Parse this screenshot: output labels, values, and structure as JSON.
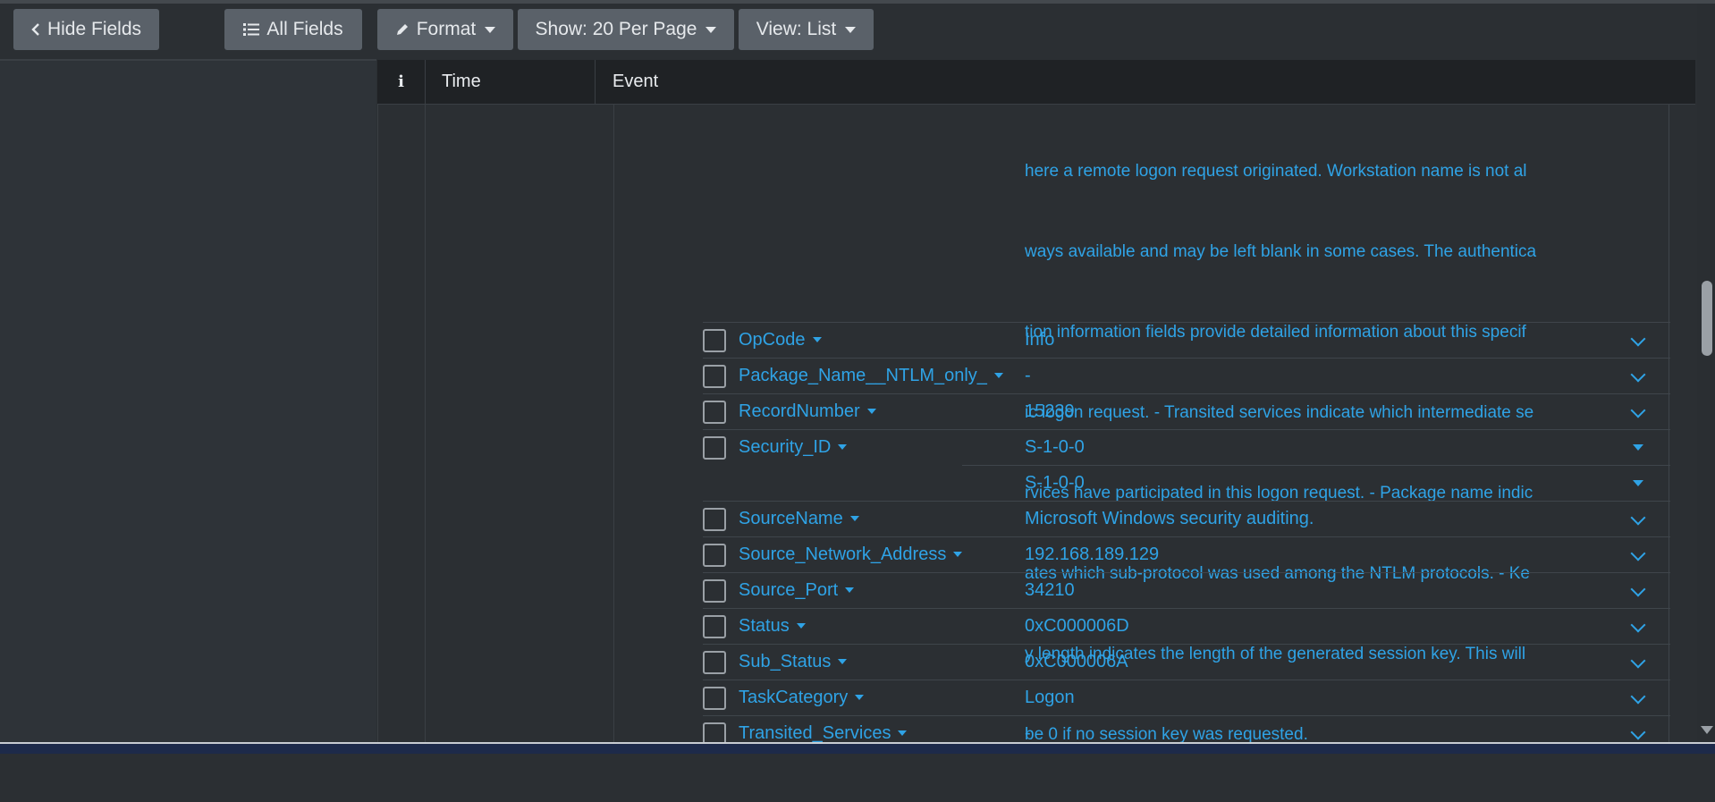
{
  "toolbar": {
    "hide_fields": "Hide Fields",
    "all_fields": "All Fields",
    "format": "Format",
    "show": "Show: 20 Per Page",
    "view": "View: List"
  },
  "table": {
    "col_info": "i",
    "col_time": "Time",
    "col_event": "Event"
  },
  "message_lines": [
    "here a remote logon request originated. Workstation name is not al",
    "ways available and may be left blank in some cases. The authentica",
    "tion information fields provide detailed information about this specif",
    "ic logon request. - Transited services indicate which intermediate se",
    "rvices have participated in this logon request. - Package name indic",
    "ates which sub-protocol was used among the NTLM protocols. - Ke",
    "y length indicates the length of the generated session key. This will",
    "be 0 if no session key was requested."
  ],
  "fields": [
    {
      "name": "OpCode",
      "value": "Info"
    },
    {
      "name": "Package_Name__NTLM_only_",
      "value": "-"
    },
    {
      "name": "RecordNumber",
      "value": "15239"
    },
    {
      "name": "Security_ID",
      "value": "S-1-0-0",
      "value2": "S-1-0-0"
    },
    {
      "name": "SourceName",
      "value": "Microsoft Windows security auditing."
    },
    {
      "name": "Source_Network_Address",
      "value": "192.168.189.129"
    },
    {
      "name": "Source_Port",
      "value": "34210"
    },
    {
      "name": "Status",
      "value": "0xC000006D"
    },
    {
      "name": "Sub_Status",
      "value": "0xC000006A"
    },
    {
      "name": "TaskCategory",
      "value": "Logon"
    },
    {
      "name": "Transited_Services",
      "value": "-"
    }
  ],
  "colors": {
    "accent": "#2fa3e6",
    "background": "#2b2f33",
    "header": "#1f2225",
    "button": "#5a6169"
  },
  "icons": [
    "chevron-left-icon",
    "list-icon",
    "pencil-icon",
    "caret-down-icon",
    "chevron-down-icon"
  ]
}
